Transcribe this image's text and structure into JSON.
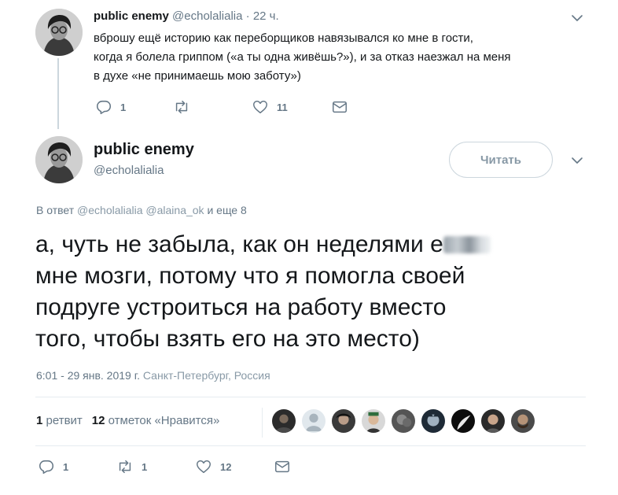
{
  "parent_tweet": {
    "name": "public enemy",
    "handle": "@echolalialia",
    "dot": " · ",
    "time": "22 ч.",
    "text_lines": [
      "вброшу ещё историю как переборщиков навязывался ко мне в гости,",
      "когда я болела гриппом («а ты одна живёшь?»), и за отказ наезжал на меня",
      "в духе «не принимаешь мою заботу»)"
    ],
    "reply_count": "1",
    "retweet_count": "",
    "like_count": "11"
  },
  "main_tweet": {
    "name": "public enemy",
    "handle": "@echolalialia",
    "follow_label": "Читать",
    "reply_prefix": "В ответ",
    "reply_mentions": "@echolalialia @alaina_ok",
    "reply_suffix": "и еще 8",
    "text_lines": [
      "а, чуть не забыла, как он неделями е",
      "мне мозги, потому что я помогла своей",
      "подруге устроиться на работу вместо",
      "того, чтобы взять его на это место)"
    ],
    "timestamp": "6:01 - 29 янв. 2019 г.",
    "location": "Санкт-Петербург, Россия",
    "retweets_num": "1",
    "retweets_label": "ретвит",
    "likes_num": "12",
    "likes_label": "отметок «Нравится»",
    "reply_count": "1",
    "retweet_count": "1",
    "like_count": "12"
  },
  "icons": [
    "reply-icon",
    "retweet-icon",
    "like-icon",
    "direct-message-icon",
    "chevron-down-icon"
  ],
  "colors": {
    "text": "#14171a",
    "secondary": "#657786",
    "border": "#e6ecf0"
  }
}
